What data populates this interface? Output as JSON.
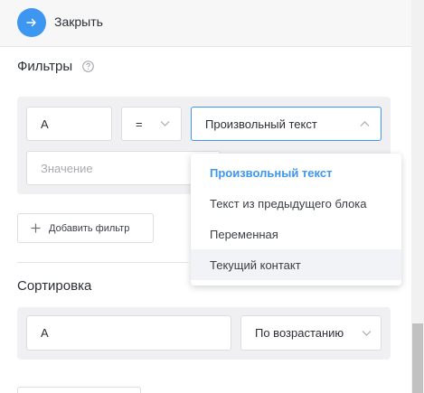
{
  "header": {
    "close_label": "Закрыть",
    "close_icon": "arrow-right-icon",
    "accent": "#3d96f0"
  },
  "filters": {
    "title": "Фильтры",
    "field_value": "A",
    "operator_value": "=",
    "type_value": "Произвольный текст",
    "value_placeholder": "Значение",
    "dropdown": {
      "items": [
        {
          "label": "Произвольный текст",
          "state": "selected"
        },
        {
          "label": "Текст из предыдущего блока",
          "state": ""
        },
        {
          "label": "Переменная",
          "state": ""
        },
        {
          "label": "Текущий контакт",
          "state": "hover"
        }
      ]
    },
    "add_button_label": "Добавить фильтр"
  },
  "sorting": {
    "title": "Сортировка",
    "field_value": "A",
    "order_value": "По возрастанию"
  }
}
